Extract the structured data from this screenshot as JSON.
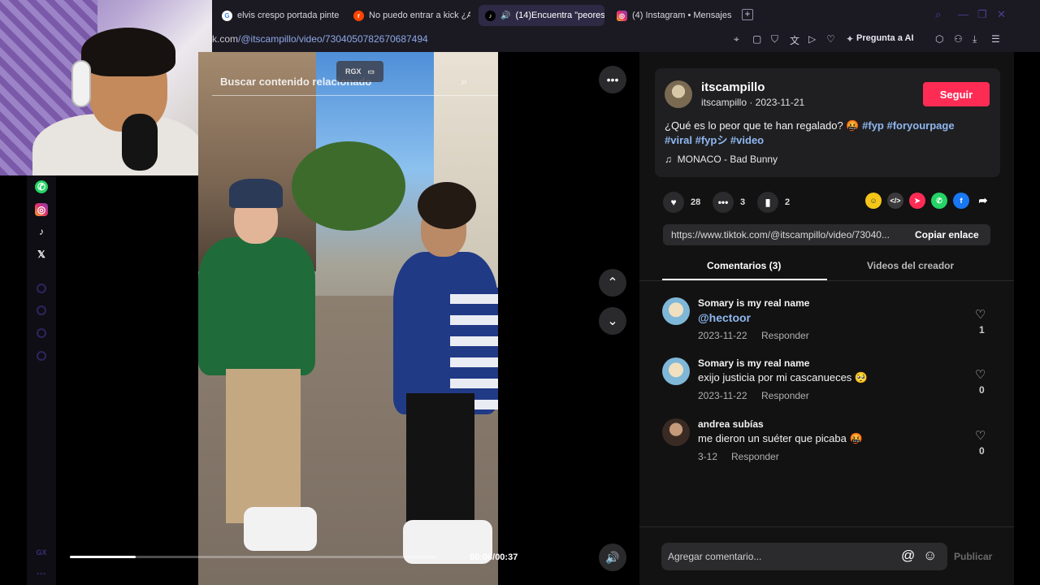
{
  "browser": {
    "tabs": [
      {
        "label": "elvis crespo portada pinte",
        "icon": "google-icon",
        "active": false
      },
      {
        "label": "No puedo entrar a kick ¿A",
        "icon": "reddit-icon",
        "active": false
      },
      {
        "label": "(14)Encuentra \"peores",
        "icon": "tiktok-icon",
        "active": true
      },
      {
        "label": "(4) Instagram • Mensajes",
        "icon": "instagram-icon",
        "active": false
      }
    ],
    "url_prefix": "k.com",
    "url_path": "/@itscampillo/video/7304050782670687494",
    "ai_button": "Pregunta a AI"
  },
  "video": {
    "search_placeholder": "Buscar contenido relacionado",
    "rgx_label": "RGX",
    "time": "00:06/00:37",
    "progress": 0.18
  },
  "post": {
    "author": "itscampillo",
    "author_sub": "itscampillo · 2023-11-21",
    "follow_label": "Seguir",
    "caption_text": "¿Qué es lo peor que te han regalado? 🤬",
    "hashtags_line1": "#fyp #foryourpage",
    "hashtags_line2": "#viral #fypシ #video",
    "music": "MONACO - Bad Bunny",
    "likes": "28",
    "comments": "3",
    "saves": "2",
    "share_link": "https://www.tiktok.com/@itscampillo/video/73040...",
    "copy_label": "Copiar enlace"
  },
  "tabs": {
    "comments": "Comentarios (3)",
    "creator": "Videos del creador"
  },
  "comments": [
    {
      "user": "Somary is my real name",
      "text": "@hectoor",
      "date": "2023-11-22",
      "reply": "Responder",
      "likes": "1"
    },
    {
      "user": "Somary is my real name",
      "text": "exijo justicia por mi cascanueces 🥺",
      "date": "2023-11-22",
      "reply": "Responder",
      "likes": "0"
    },
    {
      "user": "andrea subías",
      "text": "me dieron un suéter que picaba 🤬",
      "date": "3-12",
      "reply": "Responder",
      "likes": "0"
    }
  ],
  "composer": {
    "placeholder": "Agregar comentario...",
    "publish": "Publicar"
  },
  "sidebar": {
    "gx_label": "GX"
  },
  "colors": {
    "accent": "#fe2c55",
    "hashtag": "#8fb7f0",
    "panel_bg": "#121212"
  }
}
